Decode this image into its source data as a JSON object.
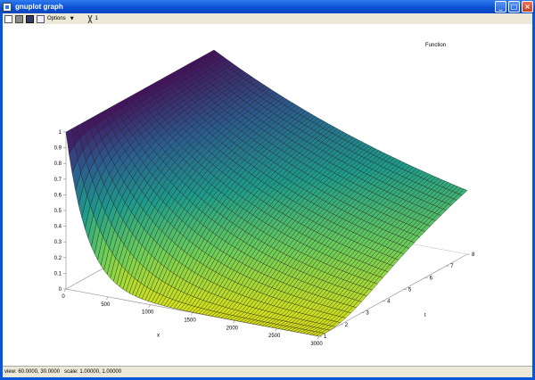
{
  "window": {
    "title": "gnuplot graph"
  },
  "toolbar": {
    "options_label": "Options",
    "replot_label": "1"
  },
  "status": {
    "text": "view: 60.0000, 30.0000   scale: 1.00000, 1.00000"
  },
  "chart_data": {
    "type": "surface",
    "legend_title": "Function",
    "xlabel": "x",
    "ylabel": "t",
    "zlabel": "",
    "x_ticks": [
      "0",
      "500",
      "1000",
      "1500",
      "2000",
      "2500",
      "3000"
    ],
    "t_ticks": [
      "1",
      "2",
      "3",
      "4",
      "5",
      "6",
      "7",
      "8"
    ],
    "z_ticks": [
      "0",
      "0.1",
      "0.2",
      "0.3",
      "0.4",
      "0.5",
      "0.6",
      "0.7",
      "0.8",
      "0.9",
      "1"
    ],
    "xlim": [
      0,
      3000
    ],
    "tlim": [
      1,
      8
    ],
    "zlim": [
      0,
      1
    ],
    "view": [
      60,
      30
    ],
    "colormap": [
      "#45115c",
      "#2b5d8f",
      "#1e9c8a",
      "#6cce59",
      "#d8e219"
    ],
    "grid_lines_x": 80,
    "grid_lines_t": 28,
    "corner_values": [
      {
        "x": 0,
        "t": 1,
        "z": 1.0
      },
      {
        "x": 3000,
        "t": 1,
        "z": 0.0
      },
      {
        "x": 0,
        "t": 8,
        "z": 1.0
      },
      {
        "x": 3000,
        "t": 8,
        "z": 0.5
      }
    ]
  }
}
